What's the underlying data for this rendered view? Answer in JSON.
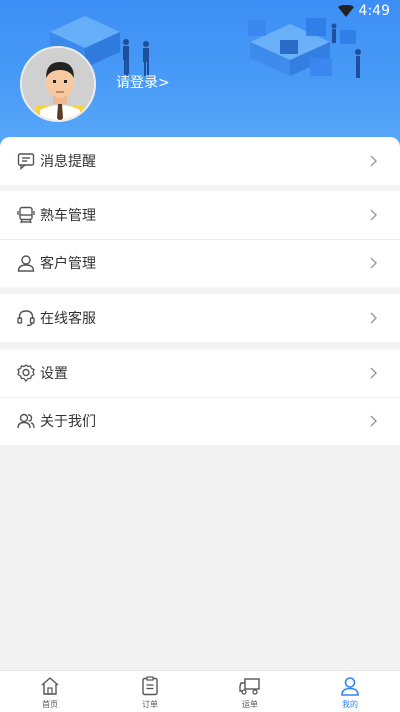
{
  "status_bar": {
    "time": "4:49"
  },
  "profile": {
    "login_text": "请登录>"
  },
  "menu": {
    "groups": [
      {
        "items": [
          {
            "label": "消息提醒",
            "icon": "message-icon"
          }
        ]
      },
      {
        "items": [
          {
            "label": "熟车管理",
            "icon": "vehicle-icon"
          },
          {
            "label": "客户管理",
            "icon": "user-icon"
          }
        ]
      },
      {
        "items": [
          {
            "label": "在线客服",
            "icon": "headset-icon"
          }
        ]
      },
      {
        "items": [
          {
            "label": "设置",
            "icon": "gear-icon"
          },
          {
            "label": "关于我们",
            "icon": "users-icon"
          }
        ]
      }
    ]
  },
  "tabbar": {
    "tabs": [
      {
        "label": "首页",
        "icon": "home-icon"
      },
      {
        "label": "订单",
        "icon": "order-icon"
      },
      {
        "label": "运单",
        "icon": "truck-icon"
      },
      {
        "label": "我的",
        "icon": "profile-icon",
        "active": true
      }
    ]
  },
  "colors": {
    "header": "#4a9cf7",
    "accent": "#2f86f6",
    "background": "#f3f3f3"
  }
}
